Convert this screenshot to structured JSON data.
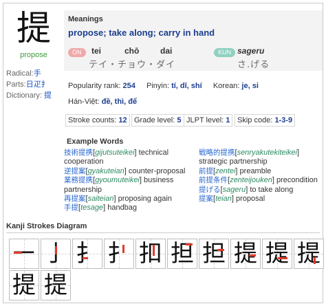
{
  "kanji": {
    "character": "提",
    "meaning": "propose"
  },
  "meta": {
    "radical_label": "Radical:",
    "radical_value": "手",
    "parts_label": "Parts:",
    "parts_value": "日疋扌",
    "dictionary_label": "Dictionary:",
    "dictionary_value": "提"
  },
  "meanings": {
    "title": "Meanings",
    "text": "propose; take along; carry in hand",
    "on_badge": "ON",
    "kun_badge": "KUN",
    "on_readings": [
      {
        "romaji": "tei"
      },
      {
        "romaji": "chō"
      },
      {
        "romaji": "dai"
      }
    ],
    "on_kana": "テイ・チョウ・ダイ",
    "kun_romaji": "sageru",
    "kun_kana": "さ.げる"
  },
  "info": {
    "popularity_label": "Popularity rank:",
    "popularity_value": "254",
    "pinyin_label": "Pinyin:",
    "pinyin_value": "tí, dǐ, shí",
    "korean_label": "Korean:",
    "korean_value": "je, si",
    "hanviet_label": "Hán-Việt:",
    "hanviet_value": "đề, thì, để",
    "stroke_label": "Stroke counts:",
    "stroke_value": "12",
    "grade_label": "Grade level:",
    "grade_value": "5",
    "jlpt_label": "JLPT level:",
    "jlpt_value": "1",
    "skip_label": "Skip code:",
    "skip_value": "1-3-9"
  },
  "examples": {
    "title": "Example Words",
    "left": [
      {
        "jp": "技術提携",
        "rm": "gijutsuteikei",
        "en": " technical",
        "en2": "cooperation"
      },
      {
        "jp": "逆提案",
        "rm": "gyakuteian",
        "en": " counter-proposal"
      },
      {
        "jp": "業務提携",
        "rm": "gyoumuteikei",
        "en": " business",
        "en2": "partnership"
      },
      {
        "jp": "再提案",
        "rm": "saiteian",
        "en": " proposing again"
      },
      {
        "jp": "手提",
        "rm": "tesage",
        "en": " handbag"
      }
    ],
    "right": [
      {
        "jp": "戦略的提携",
        "rm": "senryakutekiteikei",
        "en": "",
        "en2": "strategic partnership"
      },
      {
        "jp": "前提",
        "rm": "zentei",
        "en": " preamble"
      },
      {
        "jp": "前提条件",
        "rm": "zenteijouken",
        "en": " precondition"
      },
      {
        "jp": "提げる",
        "rm": "sageru",
        "en": " to take along"
      },
      {
        "jp": "提案",
        "rm": "teian",
        "en": " proposal"
      }
    ]
  },
  "strokes": {
    "title": "Kanji Strokes Diagram",
    "frames": [
      "㇐",
      "亅",
      "扌",
      "扌",
      "扣",
      "担",
      "担",
      "提",
      "提",
      "提",
      "提",
      "提"
    ]
  },
  "colors": {
    "accent": "#1b3e8f",
    "on_badge": "#f0a9a9",
    "kun_badge": "#8fd1c0",
    "stroke_mark": "#e23a2a"
  }
}
